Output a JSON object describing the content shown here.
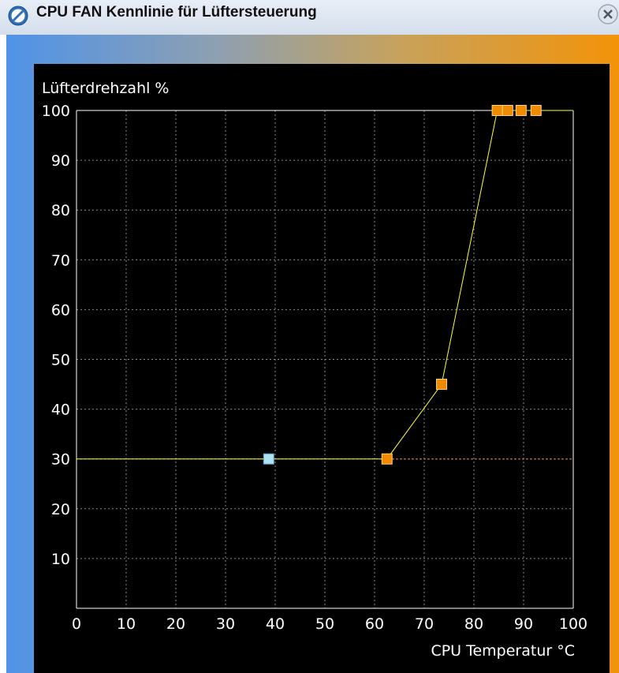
{
  "window": {
    "title": "CPU FAN Kennlinie für Lüftersteuerung"
  },
  "icons": {
    "title": "no-entry-icon",
    "close": "close-icon"
  },
  "colors": {
    "curve": "#ffff33",
    "point_orange": "#f08a00",
    "point_selected": "#aee3f5",
    "extension": "#d46a10",
    "grid": "#8a8a8a",
    "axis": "#ffffff",
    "background": "#000000"
  },
  "chart_data": {
    "type": "line",
    "ylabel": "Lüfterdrehzahl %",
    "xlabel": "CPU Temperatur °C",
    "xlim": [
      0,
      100
    ],
    "ylim": [
      0,
      100
    ],
    "x_ticks": [
      "0",
      "10",
      "20",
      "30",
      "40",
      "50",
      "60",
      "70",
      "80",
      "90",
      "100"
    ],
    "y_ticks": [
      "10",
      "20",
      "30",
      "40",
      "50",
      "60",
      "70",
      "80",
      "90",
      "100"
    ],
    "grid": true,
    "selected_point": {
      "x": 38.7,
      "y": 30
    },
    "points": [
      {
        "x": 62.5,
        "y": 30
      },
      {
        "x": 73.5,
        "y": 45
      },
      {
        "x": 84.7,
        "y": 100
      },
      {
        "x": 86.8,
        "y": 100
      },
      {
        "x": 89.5,
        "y": 100
      },
      {
        "x": 92.5,
        "y": 100
      }
    ]
  }
}
